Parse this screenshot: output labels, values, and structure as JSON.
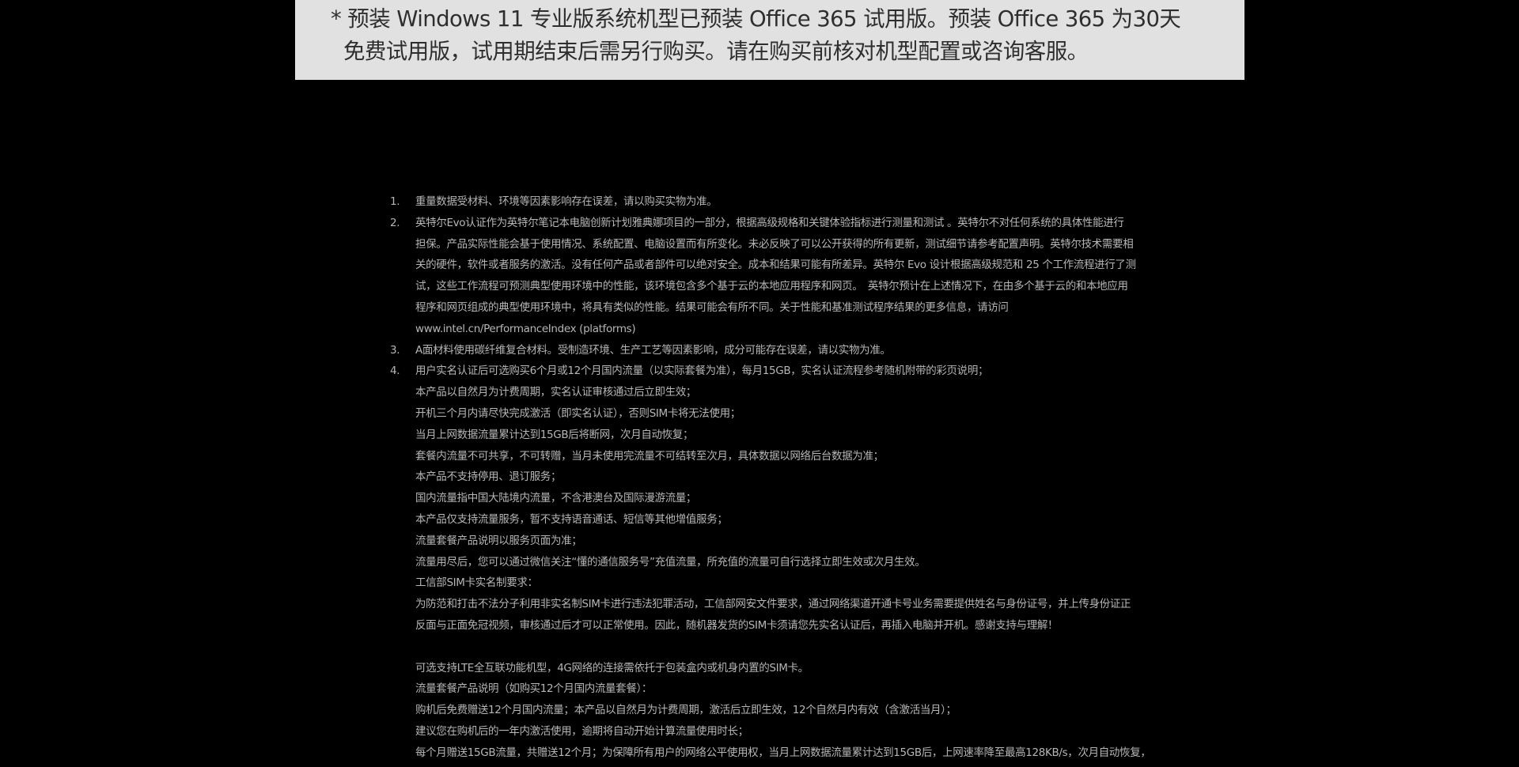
{
  "banner": {
    "line1": "* 预装 Windows 11 专业版系统机型已预装 Office 365 试用版。预装 Office 365 为30天",
    "line2": "免费试用版，试用期结束后需另行购买。请在购买前核对机型配置或咨询客服。"
  },
  "notes": [
    {
      "num": "1.",
      "lines": [
        "重量数据受材料、环境等因素影响存在误差，请以购买实物为准。"
      ]
    },
    {
      "num": "2.",
      "lines": [
        "英特尔Evo认证作为英特尔笔记本电脑创新计划雅典娜项目的一部分，根据高级规格和关键体验指标进行测量和测试 。英特尔不对任何系统的具体性能进行",
        "担保。产品实际性能会基于使用情况、系统配置、电脑设置而有所变化。未必反映了可以公开获得的所有更新，测试细节请参考配置声明。英特尔技术需要相",
        "关的硬件，软件或者服务的激活。没有任何产品或者部件可以绝对安全。成本和结果可能有所差异。英特尔 Evo 设计根据高级规范和 25 个工作流程进行了测",
        "试，这些工作流程可预测典型使用环境中的性能，该环境包含多个基于云的本地应用程序和网页。　英特尔预计在上述情况下，在由多个基于云的和本地应用",
        "程序和网页组成的典型使用环境中，将具有类似的性能。结果可能会有所不同。关于性能和基准测试程序结果的更多信息，请访问",
        "www.intel.cn/PerformanceIndex (platforms)"
      ]
    },
    {
      "num": "3.",
      "lines": [
        "A面材料使用碳纤维复合材料。受制造环境、生产工艺等因素影响，成分可能存在误差，请以实物为准。"
      ]
    },
    {
      "num": "4.",
      "lines": [
        "用户实名认证后可选购买6个月或12个月国内流量（以实际套餐为准），每月15GB，实名认证流程参考随机附带的彩页说明；",
        "本产品以自然月为计费周期，实名认证审核通过后立即生效；",
        "开机三个月内请尽快完成激活（即实名认证），否则SIM卡将无法使用；",
        "当月上网数据流量累计达到15GB后将断网，次月自动恢复；",
        "套餐内流量不可共享，不可转赠，当月未使用完流量不可结转至次月，具体数据以网络后台数据为准；",
        "本产品不支持停用、退订服务；",
        "国内流量指中国大陆境内流量，不含港澳台及国际漫游流量；",
        "本产品仅支持流量服务，暂不支持语音通话、短信等其他增值服务；",
        "流量套餐产品说明以服务页面为准；",
        "流量用尽后，您可以通过微信关注“懂的通信服务号”充值流量，所充值的流量可自行选择立即生效或次月生效。",
        "工信部SIM卡实名制要求：",
        "为防范和打击不法分子利用非实名制SIM卡进行违法犯罪活动，工信部网安文件要求，通过网络渠道开通卡号业务需要提供姓名与身份证号，并上传身份证正",
        "反面与正面免冠视频，审核通过后才可以正常使用。因此，随机器发货的SIM卡须请您先实名认证后，再插入电脑并开机。感谢支持与理解！",
        "",
        "可选支持LTE全互联功能机型，4G网络的连接需依托于包装盒内或机身内置的SIM卡。",
        "流量套餐产品说明（如购买12个月国内流量套餐）：",
        "购机后免费赠送12个月国内流量；本产品以自然月为计费周期，激活后立即生效，12个自然月内有效（含激活当月）；",
        "建议您在购机后的一年内激活使用，逾期将自动开始计算流量使用时长；",
        "每个月赠送15GB流量，共赠送12个月；为保障所有用户的网络公平使用权，当月上网数据流量累计达到15GB后，上网速率降至最高128KB/s，次月自动恢复，"
      ]
    }
  ]
}
